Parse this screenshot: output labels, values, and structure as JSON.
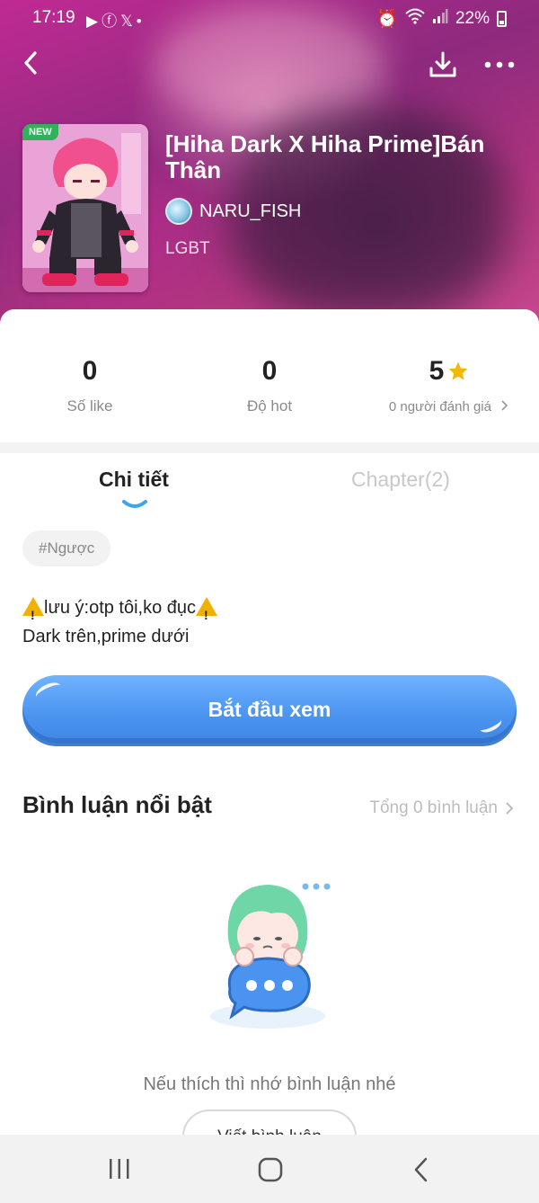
{
  "status_bar": {
    "time": "17:19",
    "left_icons": [
      "youtube-icon",
      "facebook-icon",
      "x-icon",
      "dot-icon"
    ],
    "battery": "22%"
  },
  "header": {
    "new_badge": "NEW",
    "title": "[Hiha Dark X Hiha Prime]Bán Thân",
    "author": "NARU_FISH",
    "genre": "LGBT"
  },
  "stats": [
    {
      "value": "0",
      "label": "Số like"
    },
    {
      "value": "0",
      "label": "Độ hot"
    },
    {
      "value": "5",
      "label": "0 người đánh giá"
    }
  ],
  "tabs": {
    "detail": "Chi tiết",
    "chapter": "Chapter(2)"
  },
  "tag": "#Ngược",
  "description": {
    "line1": "lưu ý:otp tôi,ko đục",
    "line2": "Dark trên,prime dưới"
  },
  "start_button": "Bắt đầu xem",
  "comments": {
    "heading": "Bình luận nổi bật",
    "total": "Tổng 0 bình luận",
    "empty_prompt": "Nếu thích thì nhớ bình luận nhé",
    "write_button": "Viết bình luận"
  },
  "colors": {
    "accent_blue": "#4a94f0",
    "star": "#f5b800",
    "new_badge": "#2fb35a"
  }
}
